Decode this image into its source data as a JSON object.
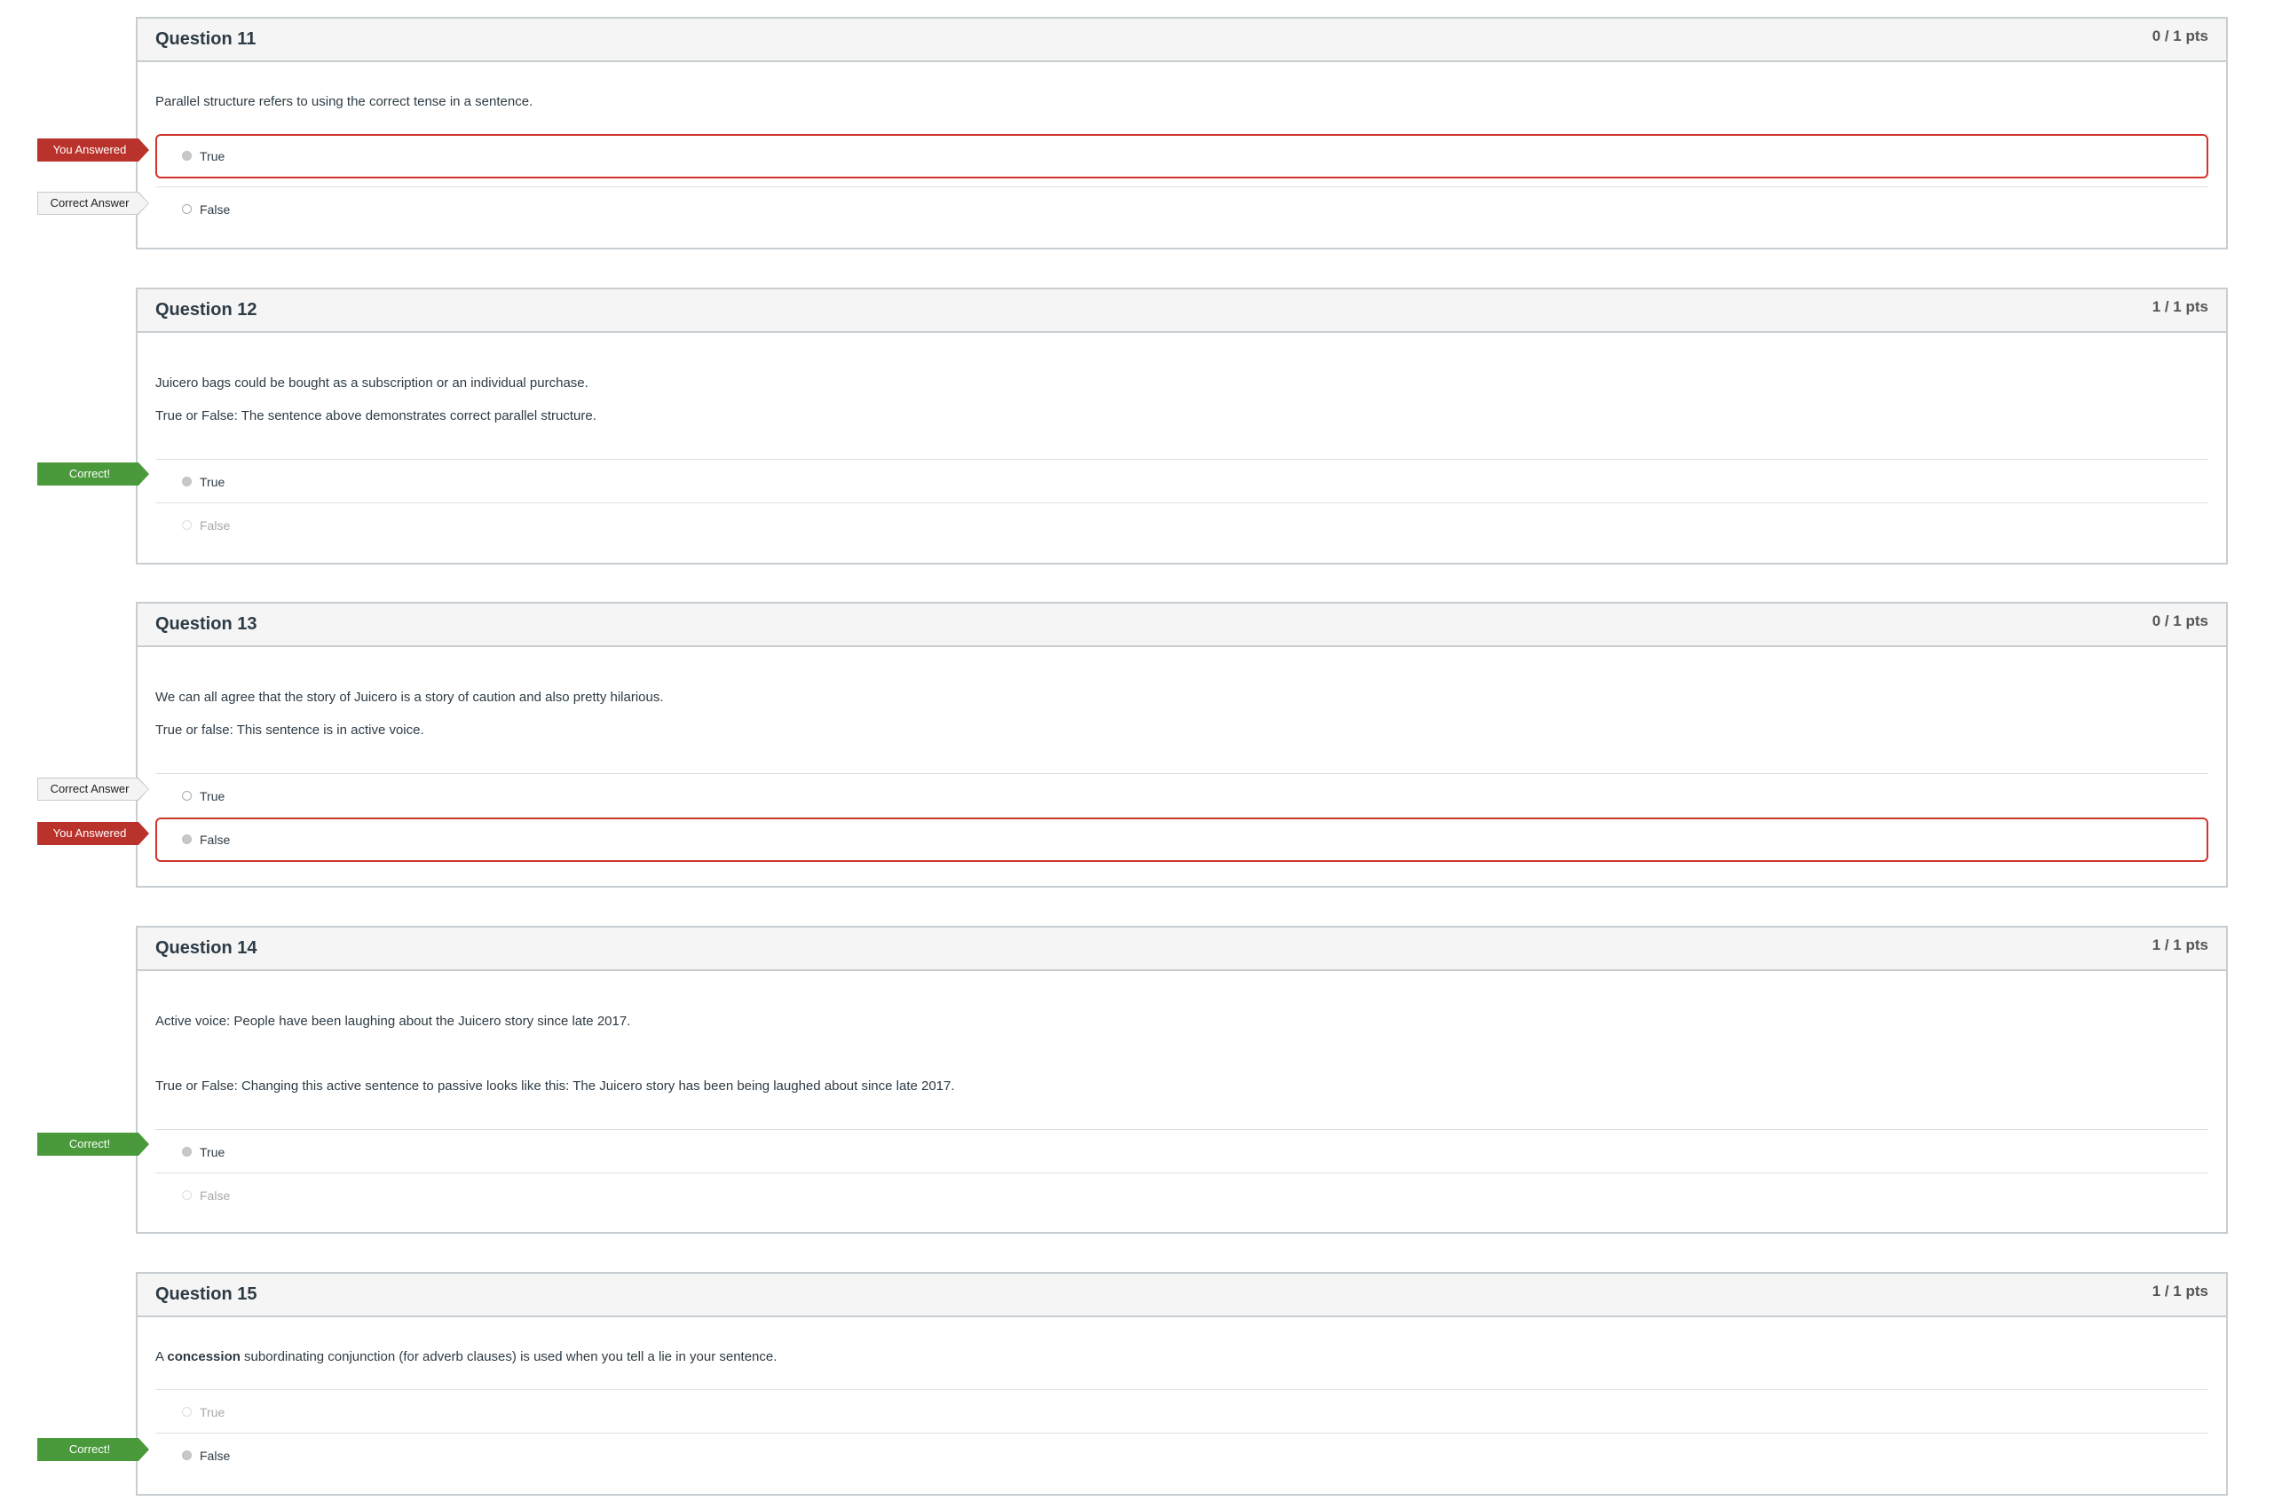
{
  "questions": [
    {
      "title": "Question 11",
      "pts": "0 / 1 pts",
      "text": [
        "Parallel structure refers to using the correct tense in a sentence."
      ],
      "answers": [
        {
          "label": "True",
          "tag": "You Answered"
        },
        {
          "label": "False",
          "tag": "Correct Answer"
        }
      ]
    },
    {
      "title": "Question 12",
      "pts": "1 / 1 pts",
      "text": [
        "Juicero bags could be bought as a subscription or an individual purchase.",
        "True or False: The sentence above demonstrates correct parallel structure."
      ],
      "answers": [
        {
          "label": "True",
          "tag": "Correct!"
        },
        {
          "label": "False",
          "tag": ""
        }
      ]
    },
    {
      "title": "Question 13",
      "pts": "0 / 1 pts",
      "text": [
        "We can all agree that the story of Juicero is a story of caution and also pretty hilarious.",
        "True or false: This sentence is in active voice."
      ],
      "answers": [
        {
          "label": "True",
          "tag": "Correct Answer"
        },
        {
          "label": "False",
          "tag": "You Answered"
        }
      ]
    },
    {
      "title": "Question 14",
      "pts": "1 / 1 pts",
      "text": [
        "Active voice: People have been laughing about the Juicero story since late 2017.",
        "True or False: Changing this active sentence to passive looks like this: The Juicero story has been being laughed about since late 2017."
      ],
      "answers": [
        {
          "label": "True",
          "tag": "Correct!"
        },
        {
          "label": "False",
          "tag": ""
        }
      ]
    },
    {
      "title": "Question 15",
      "pts": "1 / 1 pts",
      "text_parts": {
        "before": "A ",
        "bold": "concession",
        "after": " subordinating conjunction (for adverb clauses) is used when you tell a lie in your sentence."
      },
      "answers": [
        {
          "label": "True",
          "tag": ""
        },
        {
          "label": "False",
          "tag": "Correct!"
        }
      ]
    }
  ],
  "colors": {
    "wrong": "#d0342c",
    "correct": "#4a9a3b",
    "border": "#c7cdd1"
  }
}
